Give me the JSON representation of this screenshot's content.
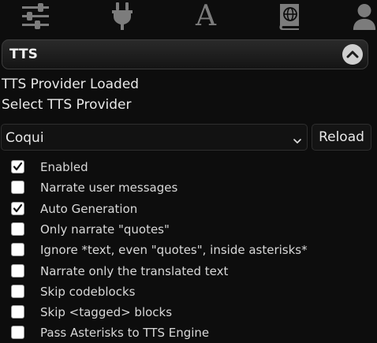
{
  "top_bar": {
    "icons": [
      "sliders-icon",
      "plug-icon",
      "font-letter-icon",
      "world-book-icon",
      "user-icon"
    ],
    "letter": "A"
  },
  "drawer": {
    "title": "TTS",
    "collapse_icon": "chevron-up-icon"
  },
  "status": {
    "loaded": "TTS Provider Loaded",
    "select_label": "Select TTS Provider"
  },
  "provider": {
    "selected": "Coqui",
    "reload_label": "Reload"
  },
  "options": [
    {
      "label": "Enabled",
      "checked": true
    },
    {
      "label": "Narrate user messages",
      "checked": false
    },
    {
      "label": "Auto Generation",
      "checked": true
    },
    {
      "label": "Only narrate \"quotes\"",
      "checked": false
    },
    {
      "label": "Ignore *text, even \"quotes\", inside asterisks*",
      "checked": false
    },
    {
      "label": "Narrate only the translated text",
      "checked": false
    },
    {
      "label": "Skip codeblocks",
      "checked": false
    },
    {
      "label": "Skip <tagged> blocks",
      "checked": false
    },
    {
      "label": "Pass Asterisks to TTS Engine",
      "checked": false
    }
  ]
}
